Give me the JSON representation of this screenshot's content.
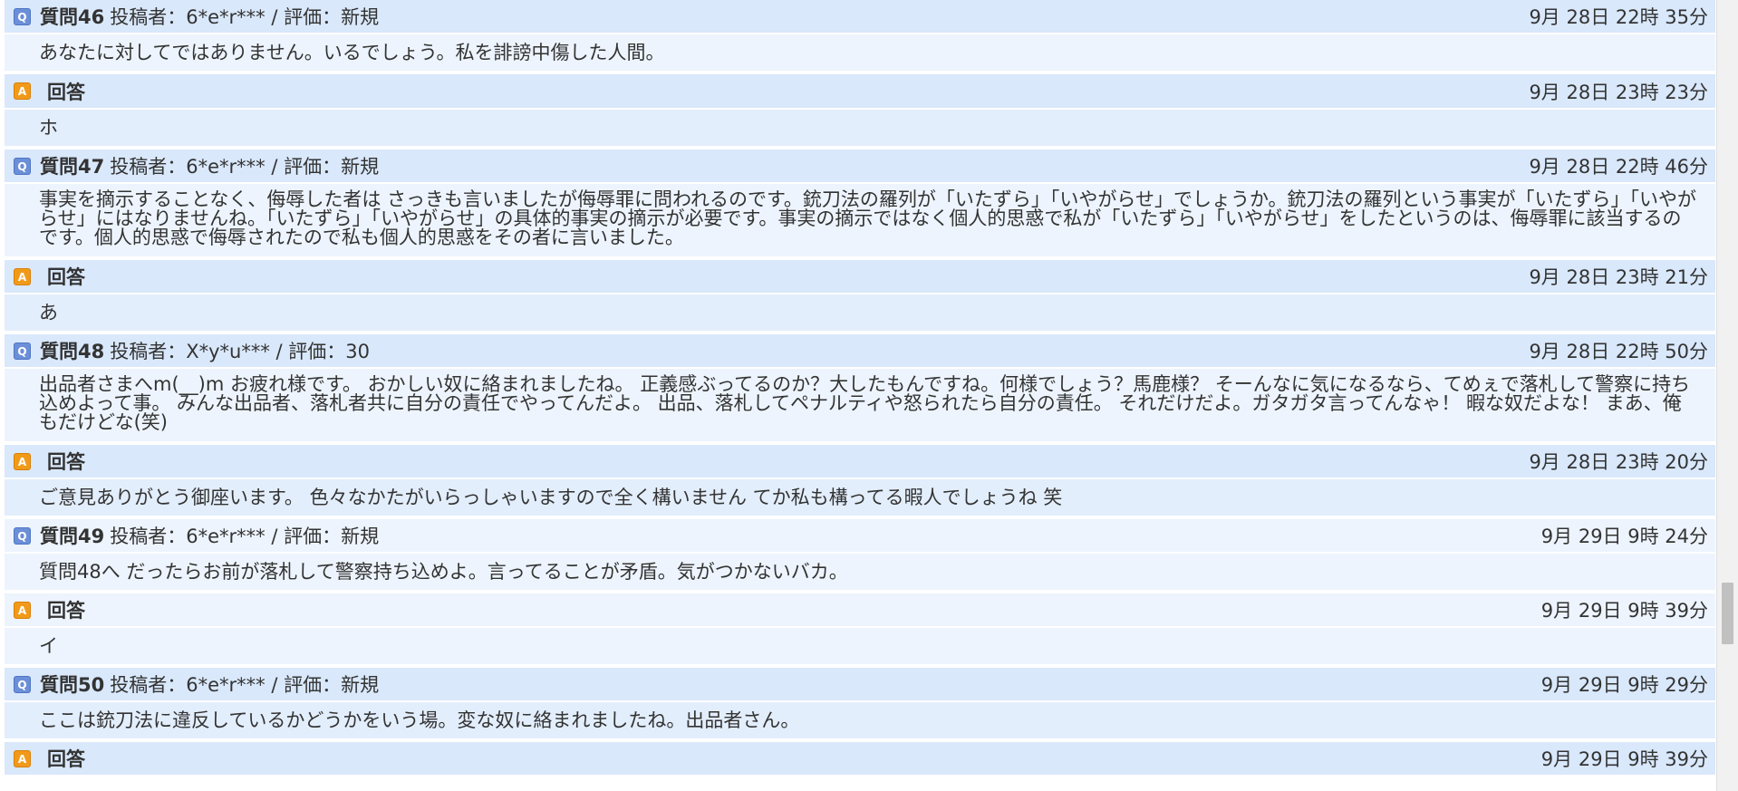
{
  "colors": {
    "question_header_bg": "#d9e8fb",
    "question_body_bg": "#edf4fd",
    "answer_body_bg": "#e3eefc",
    "q_badge": "#6b8fd8",
    "a_badge": "#f19a1a"
  },
  "badges": {
    "question": "Q",
    "answer": "A"
  },
  "items": [
    {
      "q_title": "質問46",
      "q_meta": "投稿者：6*e*r*** / 評価：新規",
      "q_date": "9月 28日 22時 35分",
      "q_text": "あなたに対してではありません。いるでしょう。私を誹謗中傷した人間。",
      "a_title": "回答",
      "a_date": "9月 28日 23時 23分",
      "a_text": "ホ"
    },
    {
      "q_title": "質問47",
      "q_meta": "投稿者：6*e*r*** / 評価：新規",
      "q_date": "9月 28日 22時 46分",
      "q_text": "事実を摘示することなく、侮辱した者は さっきも言いましたが侮辱罪に問われるのです。銃刀法の羅列が「いたずら」「いやがらせ」でしょうか。銃刀法の羅列という事実が「いたずら」「いやがらせ」にはなりませんね。「いたずら」「いやがらせ」の具体的事実の摘示が必要です。事実の摘示ではなく個人的思惑で私が「いたずら」「いやがらせ」をしたというのは、侮辱罪に該当するのです。個人的思惑で侮辱されたので私も個人的思惑をその者に言いました。",
      "a_title": "回答",
      "a_date": "9月 28日 23時 21分",
      "a_text": "あ"
    },
    {
      "q_title": "質問48",
      "q_meta": "投稿者：X*y*u*** / 評価：30",
      "q_date": "9月 28日 22時 50分",
      "q_text": "出品者さまへm(__)m お疲れ様です。 おかしい奴に絡まれましたね。 正義感ぶってるのか？大したもんですね。何様でしょう？馬鹿様？ そーんなに気になるなら、てめぇで落札して警察に持ち込めよって事。 みんな出品者、落札者共に自分の責任でやってんだよ。 出品、落札してペナルティや怒られたら自分の責任。 それだけだよ。ガタガタ言ってんなゃ！ 暇な奴だよな！ まあ、俺もだけどな(笑)",
      "a_title": "回答",
      "a_date": "9月 28日 23時 20分",
      "a_text": "ご意見ありがとう御座います。 色々なかたがいらっしゃいますので全く構いません てか私も構ってる暇人でしょうね 笑"
    },
    {
      "q_title": "質問49",
      "q_meta": "投稿者：6*e*r*** / 評価：新規",
      "q_date": "9月 29日 9時 24分",
      "q_text": "質問48へ だったらお前が落札して警察持ち込めよ。言ってることが矛盾。気がつかないバカ。",
      "a_title": "回答",
      "a_date": "9月 29日 9時 39分",
      "a_text": "イ"
    },
    {
      "q_title": "質問50",
      "q_meta": "投稿者：6*e*r*** / 評価：新規",
      "q_date": "9月 29日 9時 29分",
      "q_text": "ここは銃刀法に違反しているかどうかをいう場。変な奴に絡まれましたね。出品者さん。",
      "a_title": "回答",
      "a_date": "9月 29日 9時 39分",
      "a_text": ""
    }
  ]
}
